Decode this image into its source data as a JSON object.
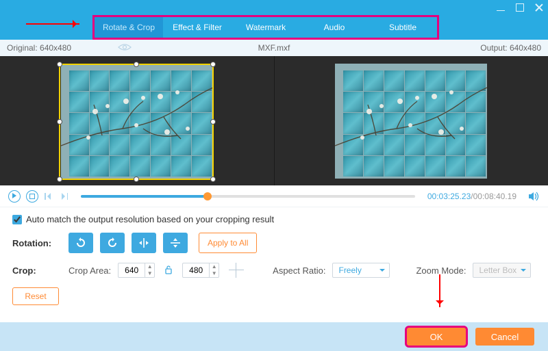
{
  "tabs": {
    "rotate": "Rotate & Crop",
    "effect": "Effect & Filter",
    "watermark": "Watermark",
    "audio": "Audio",
    "subtitle": "Subtitle"
  },
  "info": {
    "original": "Original: 640x480",
    "filename": "MXF.mxf",
    "output": "Output: 640x480"
  },
  "playback": {
    "current": "00:03:25.23",
    "total": "/00:08:40.19",
    "progress_pct": 38
  },
  "auto_match": {
    "label": "Auto match the output resolution based on your cropping result",
    "checked": true
  },
  "rotation": {
    "label": "Rotation:",
    "apply_all": "Apply to All"
  },
  "crop": {
    "label": "Crop:",
    "area_label": "Crop Area:",
    "width": "640",
    "height": "480",
    "aspect_label": "Aspect Ratio:",
    "aspect_value": "Freely",
    "zoom_label": "Zoom Mode:",
    "zoom_value": "Letter Box"
  },
  "reset": "Reset",
  "footer": {
    "ok": "OK",
    "cancel": "Cancel"
  }
}
